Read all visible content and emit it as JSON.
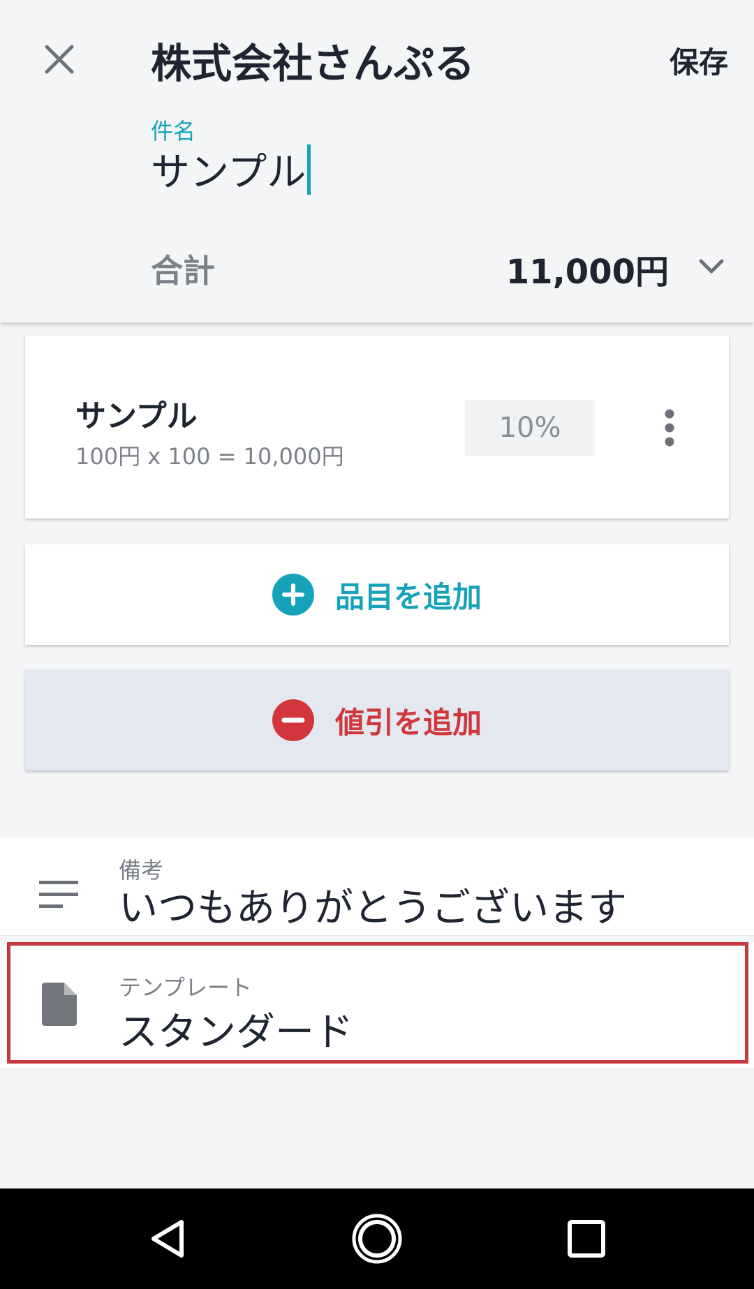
{
  "header": {
    "title": "株式会社さんぷる",
    "save_label": "保存",
    "subject_label": "件名",
    "subject_value": "サンプル",
    "total_label": "合計",
    "total_value": "11,000円"
  },
  "items": [
    {
      "name": "サンプル",
      "formula": "100円 x 100 = 10,000円",
      "tax": "10%"
    }
  ],
  "actions": {
    "add_item_label": "品目を追加",
    "add_discount_label": "値引を追加"
  },
  "notes": {
    "label": "備考",
    "value": "いつもありがとうございます"
  },
  "template": {
    "label": "テンプレート",
    "value": "スタンダード"
  },
  "colors": {
    "accent": "#16a3ba",
    "discount": "#d0363c",
    "highlight": "#c8383f"
  },
  "icons": {
    "close": "close-icon",
    "chevron": "chevron-down-icon",
    "more": "more-vert-icon",
    "add": "plus-circle-icon",
    "remove": "minus-circle-icon",
    "notes": "notes-icon",
    "template": "file-icon",
    "nav_back": "back-icon",
    "nav_home": "home-icon",
    "nav_recents": "recents-icon"
  }
}
